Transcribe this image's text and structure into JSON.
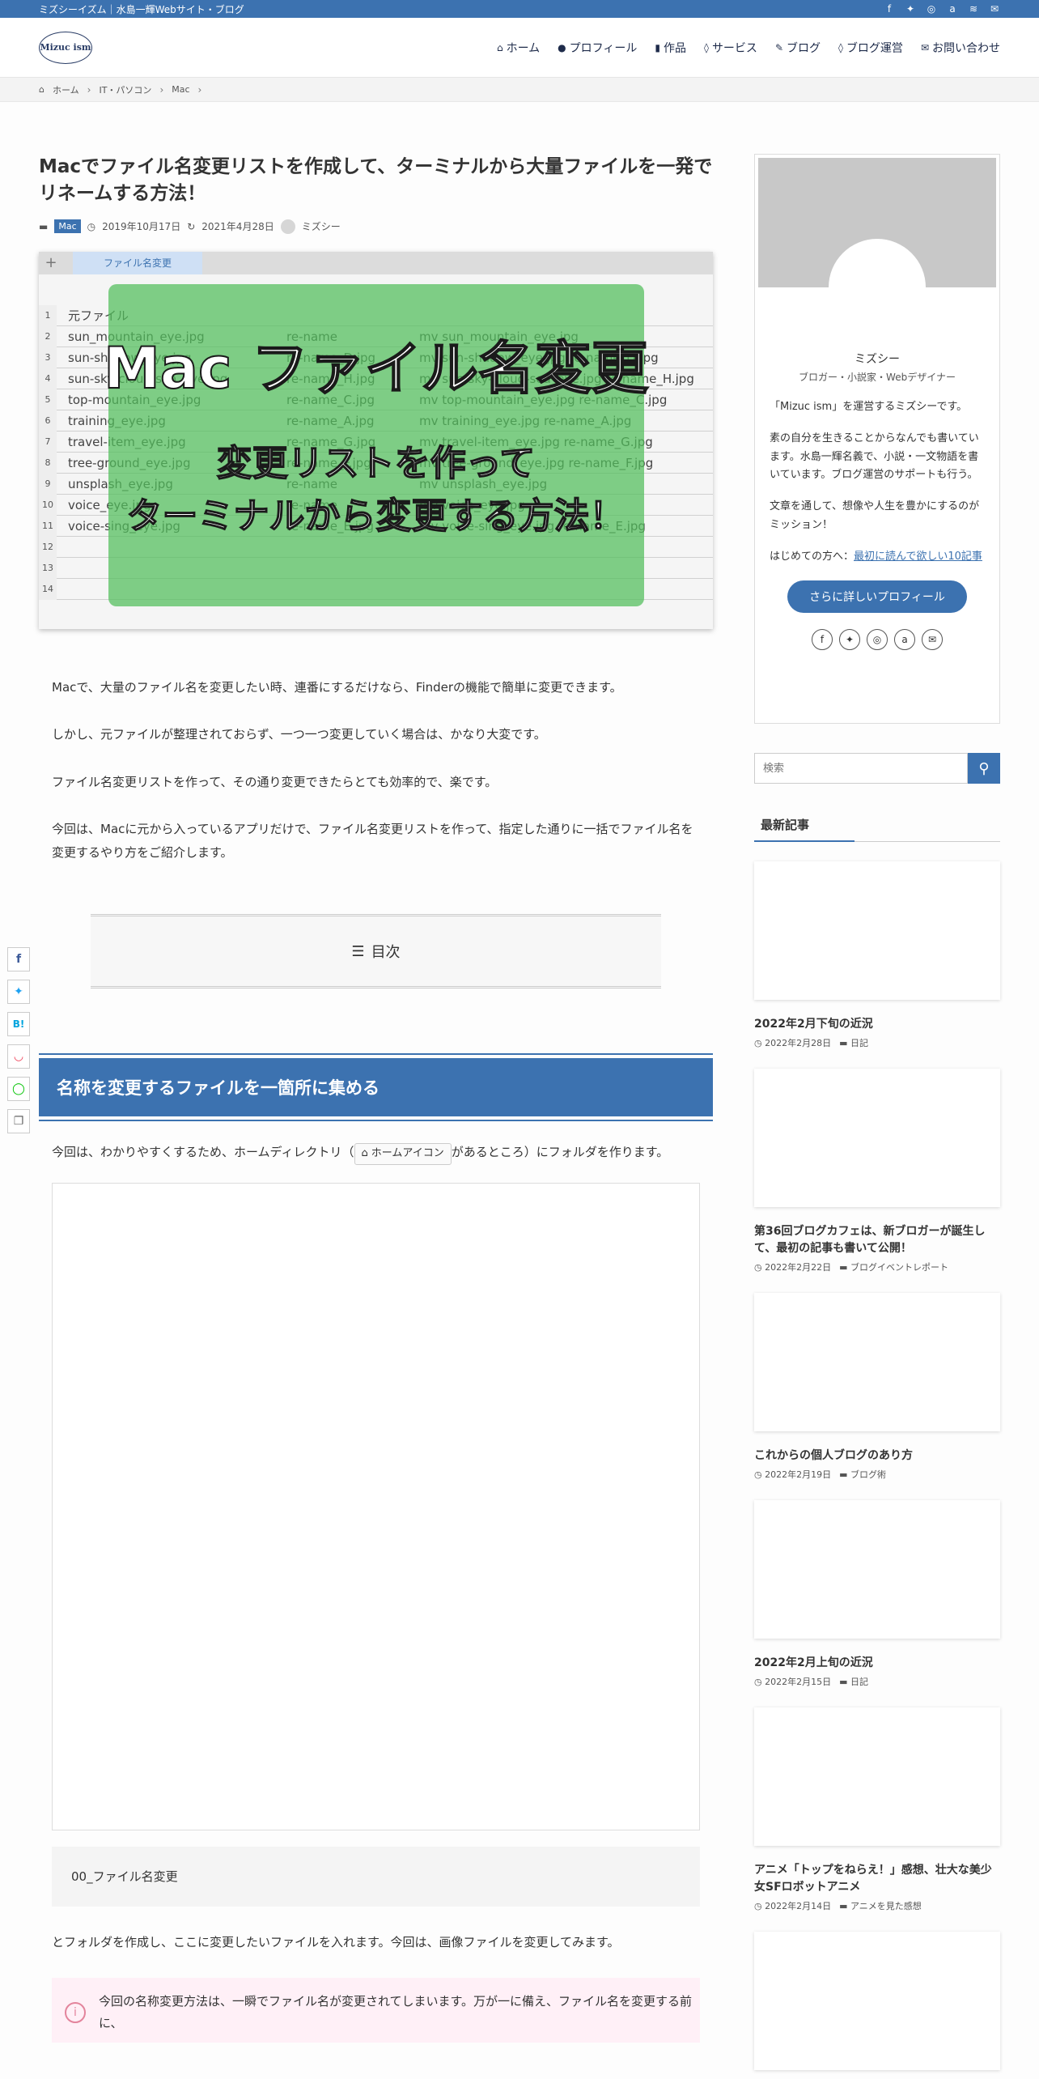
{
  "topbar": {
    "tagline": "ミズシーイズム｜水島一輝Webサイト・ブログ",
    "icons": [
      "facebook-icon",
      "twitter-icon",
      "instagram-icon",
      "amazon-icon",
      "rss-icon",
      "mail-icon"
    ]
  },
  "header": {
    "logo_text": "Mizuc ism",
    "nav": [
      {
        "label": "ホーム",
        "icon": "home-icon"
      },
      {
        "label": "プロフィール",
        "icon": "user-icon"
      },
      {
        "label": "作品",
        "icon": "book-icon"
      },
      {
        "label": "サービス",
        "icon": "pin-icon"
      },
      {
        "label": "ブログ",
        "icon": "pen-icon"
      },
      {
        "label": "ブログ運営",
        "icon": "pin-icon"
      },
      {
        "label": "お問い合わせ",
        "icon": "mail-icon"
      }
    ]
  },
  "breadcrumb": {
    "items": [
      "ホーム",
      "IT・パソコン",
      "Mac"
    ]
  },
  "post": {
    "title": "Macでファイル名変更リストを作成して、ターミナルから大量ファイルを一発でリネームする方法！",
    "category": "Mac",
    "published": "2019年10月17日",
    "updated": "2021年4月28日",
    "author": "ミズシー"
  },
  "hero": {
    "tab_label": "ファイル名変更",
    "title": "Mac ファイル名変更",
    "subtitle1": "変更リストを作って",
    "subtitle2": "ターミナルから変更する方法！",
    "rows": [
      {
        "n": "1",
        "c1": "元ファイル",
        "c2": "",
        "c3": ""
      },
      {
        "n": "2",
        "c1": "sun_mountain_eye.jpg",
        "c2": "re-name",
        "c3": "mv sun_mountain_eye.jpg"
      },
      {
        "n": "3",
        "c1": "sun-shadow_eye.jpg",
        "c2": "re-name_D.jpg",
        "c3": "mv sun-shadow_eye.jpg re-name_D.jpg"
      },
      {
        "n": "4",
        "c1": "sun-sky-cloud-sea_eye.jpg",
        "c2": "re-name_H.jpg",
        "c3": "mv sun-sky-cloud-sea_eye.jpg re-name_H.jpg"
      },
      {
        "n": "5",
        "c1": "top-mountain_eye.jpg",
        "c2": "re-name_C.jpg",
        "c3": "mv top-mountain_eye.jpg re-name_C.jpg"
      },
      {
        "n": "6",
        "c1": "training_eye.jpg",
        "c2": "re-name_A.jpg",
        "c3": "mv training_eye.jpg re-name_A.jpg"
      },
      {
        "n": "7",
        "c1": "travel-item_eye.jpg",
        "c2": "re-name_G.jpg",
        "c3": "mv travel-item_eye.jpg re-name_G.jpg"
      },
      {
        "n": "8",
        "c1": "tree-ground_eye.jpg",
        "c2": "re-name_F.jpg",
        "c3": "mv tree-ground_eye.jpg re-name_F.jpg"
      },
      {
        "n": "9",
        "c1": "unsplash_eye.jpg",
        "c2": "re-name",
        "c3": "mv unsplash_eye.jpg"
      },
      {
        "n": "10",
        "c1": "voice_eye.jpg",
        "c2": "re-name",
        "c3": "mv voice_eye.jpg"
      },
      {
        "n": "11",
        "c1": "voice-sing_eye.jpg",
        "c2": "re-name_E.jpg",
        "c3": "mv voice-sing_eye.jpg re-name_E.jpg"
      },
      {
        "n": "12",
        "c1": "",
        "c2": "",
        "c3": ""
      },
      {
        "n": "13",
        "c1": "",
        "c2": "",
        "c3": ""
      },
      {
        "n": "14",
        "c1": "",
        "c2": "",
        "c3": ""
      }
    ]
  },
  "body": {
    "p1": "Macで、大量のファイル名を変更したい時、連番にするだけなら、Finderの機能で簡単に変更できます。",
    "p2": "しかし、元ファイルが整理されておらず、一つ一つ変更していく場合は、かなり大変です。",
    "p3": "ファイル名変更リストを作って、その通り変更できたらとても効率的で、楽です。",
    "p4": "今回は、Macに元から入っているアプリだけで、ファイル名変更リストを作って、指定した通りに一括でファイル名を変更するやり方をご紹介します。",
    "toc_label": "目次",
    "h2": "名称を変更するファイルを一箇所に集める",
    "p5_before": "今回は、わかりやすくするため、ホームディレクトリ（",
    "p5_button": "ホームアイコン",
    "p5_after": "があるところ）にフォルダを作ります。",
    "code": "00_ファイル名変更",
    "p6": "とフォルダを作成し、ここに変更したいファイルを入れます。今回は、画像ファイルを変更してみます。",
    "alert": "今回の名称変更方法は、一瞬でファイル名が変更されてしまいます。万が一に備え、ファイル名を変更する前に、"
  },
  "share": [
    "f",
    "t",
    "B!",
    "p",
    "line",
    "copy"
  ],
  "sidebar": {
    "profile": {
      "name": "ミズシー",
      "role": "ブロガー・小説家・Webデザイナー",
      "d1": "「Mizuc ism」を運営するミズシーです。",
      "d2": "素の自分を生きることからなんでも書いています。水島一輝名義で、小説・一文物語を書いています。ブログ運営のサポートも行う。",
      "d3": "文章を通して、想像や人生を豊かにするのがミッション！",
      "d4_before": "はじめての方へ：",
      "d4_link": "最初に読んで欲しい10記事",
      "more_button": "さらに詳しいプロフィール"
    },
    "search_placeholder": "検索",
    "recent_title": "最新記事",
    "posts": [
      {
        "title": "2022年2月下旬の近況",
        "date": "2022年2月28日",
        "cat": "日記"
      },
      {
        "title": "第36回ブログカフェは、新ブロガーが誕生して、最初の記事も書いて公開！",
        "date": "2022年2月22日",
        "cat": "ブログイベントレポート"
      },
      {
        "title": "これからの個人ブログのあり方",
        "date": "2022年2月19日",
        "cat": "ブログ術"
      },
      {
        "title": "2022年2月上旬の近況",
        "date": "2022年2月15日",
        "cat": "日記"
      },
      {
        "title": "アニメ「トップをねらえ！」感想、壮大な美少女SFロボットアニメ",
        "date": "2022年2月14日",
        "cat": "アニメを見た感想"
      }
    ]
  },
  "colors": {
    "brand": "#3c72b0",
    "hero_overlay": "#50be5a",
    "alert_bg": "#fff0f7"
  }
}
